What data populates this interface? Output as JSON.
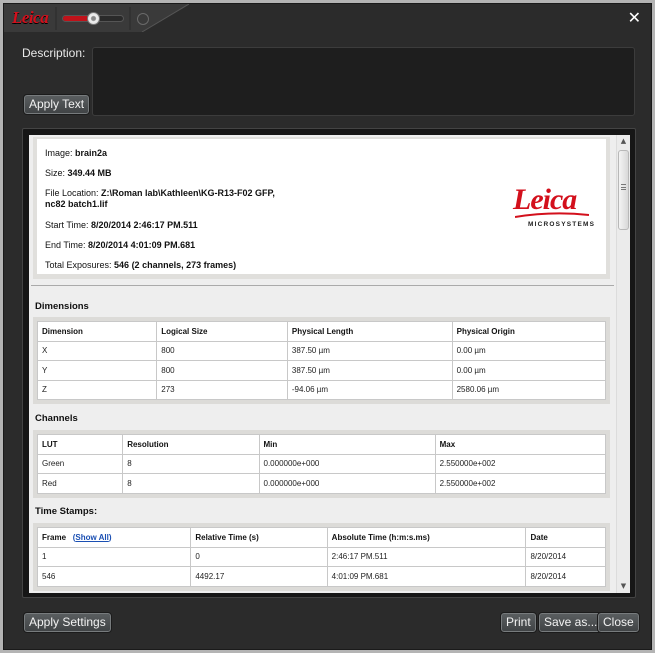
{
  "titlebar": {
    "logo_text": "Leica",
    "zoom_slider_value": 0.5,
    "close_glyph": "✕"
  },
  "description": {
    "label": "Description:",
    "value": "",
    "apply_text_label": "Apply Text"
  },
  "info": {
    "image_label": "Image: ",
    "image_value": "brain2a",
    "size_label": "Size: ",
    "size_value": "349.44 MB",
    "file_location_label": "File Location: ",
    "file_location_value_line1": "Z:\\Roman lab\\Kathleen\\KG-R13-F02 GFP,",
    "file_location_value_line2": "nc82 batch1.lif",
    "start_time_label": "Start Time: ",
    "start_time_value": "8/20/2014 2:46:17 PM.511",
    "end_time_label": "End Time: ",
    "end_time_value": "8/20/2014 4:01:09 PM.681",
    "total_exposures_label": "Total Exposures: ",
    "total_exposures_value": "546 (2 channels, 273 frames)",
    "logo_text": "Leica",
    "logo_subtitle": "MICROSYSTEMS"
  },
  "dimensions": {
    "title": "Dimensions",
    "headers": [
      "Dimension",
      "Logical Size",
      "Physical Length",
      "Physical Origin"
    ],
    "rows": [
      [
        "X",
        "800",
        "387.50 µm",
        "0.00 µm"
      ],
      [
        "Y",
        "800",
        "387.50 µm",
        "0.00 µm"
      ],
      [
        "Z",
        "273",
        "-94.06 µm",
        "2580.06 µm"
      ]
    ]
  },
  "channels": {
    "title": "Channels",
    "headers": [
      "LUT",
      "Resolution",
      "Min",
      "Max"
    ],
    "rows": [
      [
        "Green",
        "8",
        "0.000000e+000",
        "2.550000e+002"
      ],
      [
        "Red",
        "8",
        "0.000000e+000",
        "2.550000e+002"
      ]
    ]
  },
  "timestamps": {
    "title": "Time Stamps:",
    "frame_header": "Frame",
    "show_all_open": "(",
    "show_all_link": "Show All",
    "show_all_close": ")",
    "headers": [
      "Relative Time (s)",
      "Absolute Time (h:m:s.ms)",
      "Date"
    ],
    "rows": [
      [
        "1",
        "0",
        "2:46:17 PM.511",
        "8/20/2014"
      ],
      [
        "546",
        "4492.17",
        "4:01:09 PM.681",
        "8/20/2014"
      ]
    ]
  },
  "footer": {
    "apply_settings_label": "Apply Settings",
    "print_label": "Print",
    "save_as_label": "Save as...",
    "close_label": "Close"
  },
  "scrollbar": {
    "up_glyph": "▲",
    "down_glyph": "▼",
    "position_fraction": 0.0
  },
  "colors": {
    "brand_red": "#d3101c",
    "link_blue": "#1a4fb3"
  }
}
